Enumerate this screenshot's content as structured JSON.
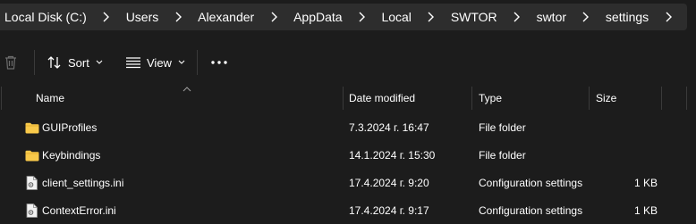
{
  "breadcrumb": {
    "items": [
      {
        "label": "Local Disk (C:)"
      },
      {
        "label": "Users"
      },
      {
        "label": "Alexander"
      },
      {
        "label": "AppData"
      },
      {
        "label": "Local"
      },
      {
        "label": "SWTOR"
      },
      {
        "label": "swtor"
      },
      {
        "label": "settings"
      }
    ]
  },
  "toolbar": {
    "sort_label": "Sort",
    "view_label": "View"
  },
  "columns": {
    "name": "Name",
    "date_modified": "Date modified",
    "type": "Type",
    "size": "Size"
  },
  "files": [
    {
      "name": "GUIProfiles",
      "date": "7.3.2024 г. 16:47",
      "type": "File folder",
      "size": "",
      "icon": "folder-icon"
    },
    {
      "name": "Keybindings",
      "date": "14.1.2024 г. 15:30",
      "type": "File folder",
      "size": "",
      "icon": "folder-icon"
    },
    {
      "name": "client_settings.ini",
      "date": "17.4.2024 г. 9:20",
      "type": "Configuration settings",
      "size": "1 KB",
      "icon": "config-file-icon"
    },
    {
      "name": "ContextError.ini",
      "date": "17.4.2024 г. 9:17",
      "type": "Configuration settings",
      "size": "1 KB",
      "icon": "config-file-icon"
    }
  ],
  "colors": {
    "background": "#1c1c1c",
    "addressbar": "#2d2d2d",
    "folder": "#f8c94a",
    "separator": "#3a3a3a"
  }
}
